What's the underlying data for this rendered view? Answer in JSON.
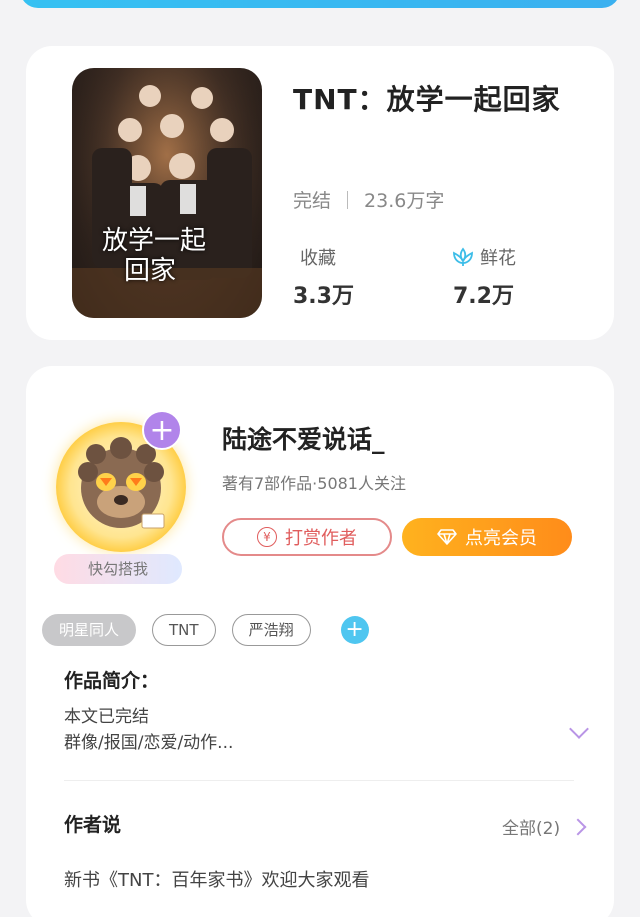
{
  "book": {
    "title": "TNT：放学一起回家",
    "status": "完结",
    "word_count": "23.6万字",
    "favorites_label": "收藏",
    "favorites_value": "3.3万",
    "flowers_label": "鲜花",
    "flowers_value": "7.2万",
    "cover_text_line1": "放学一起",
    "cover_text_line2": "回家"
  },
  "author": {
    "name": "陆途不爱说话_",
    "stats": "著有7部作品·5081人关注",
    "reward_label": "打赏作者",
    "vip_label": "点亮会员",
    "pill_label": "快勾搭我",
    "follow_plus": "+"
  },
  "tags": [
    "明星同人",
    "TNT",
    "严浩翔"
  ],
  "tag_add": "+",
  "intro": {
    "heading": "作品简介：",
    "line1": "本文已完结",
    "line2": "群像/报国/恋爱/动作..."
  },
  "author_says": {
    "heading": "作者说",
    "all_label": "全部(2)",
    "message": "新书《TNT：百年家书》欢迎大家观看"
  },
  "colors": {
    "accent_blue": "#36c1f2",
    "vip_orange": "#ff9a1e",
    "reward_red": "#e05d5d",
    "purple": "#b184ea"
  },
  "icons": {
    "reward": "yen-coin-icon",
    "vip": "diamond-icon",
    "flower": "lotus-flower-icon",
    "intro_expand": "chevron-down-icon",
    "all": "chevron-right-icon"
  }
}
